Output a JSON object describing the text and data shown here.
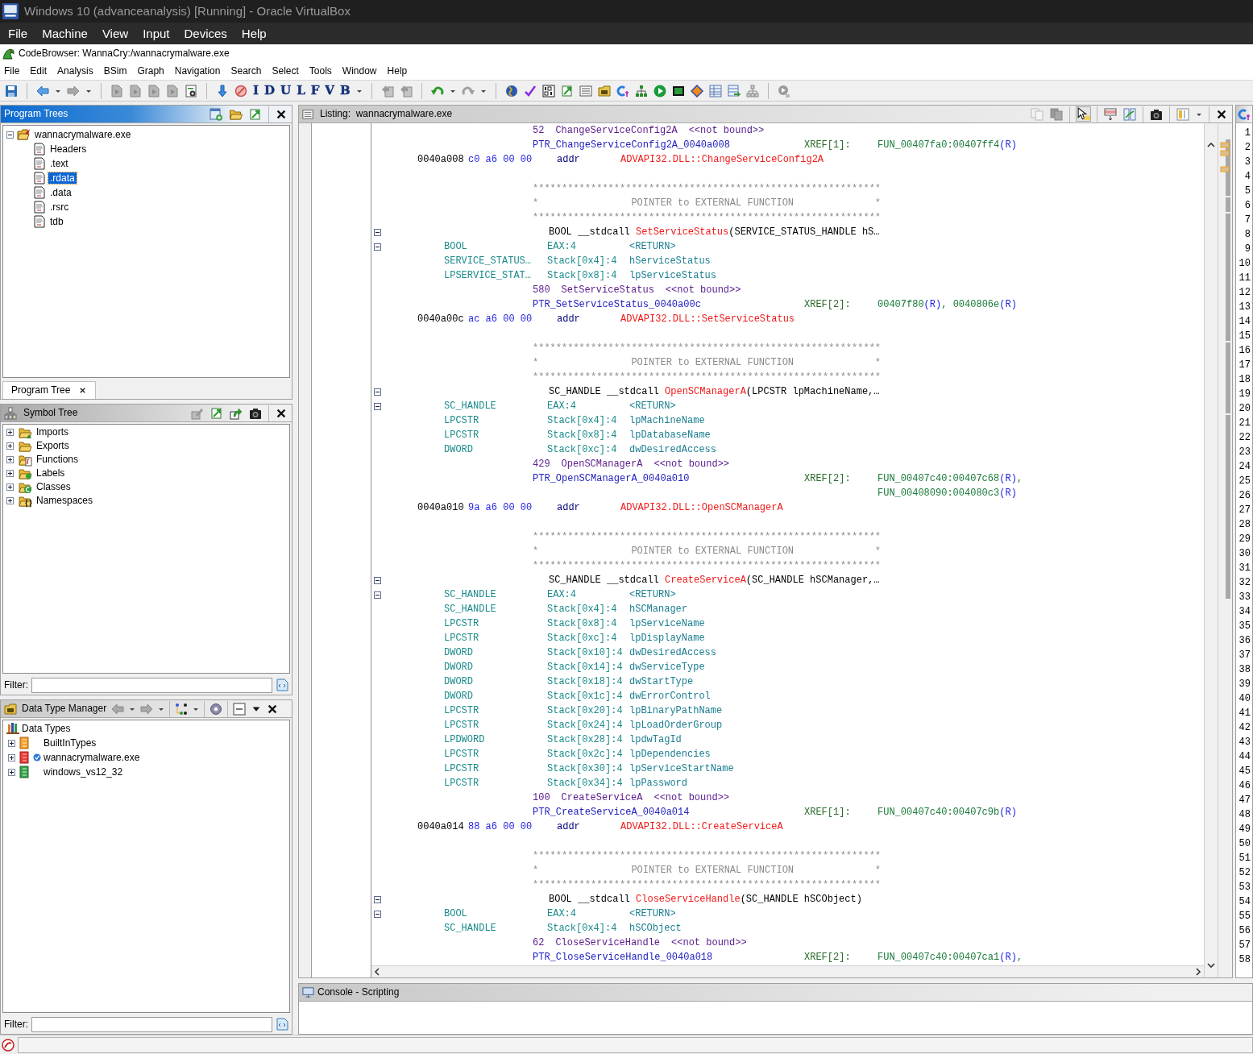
{
  "vm_window": {
    "title": "Windows 10 (advanceanalysis) [Running] - Oracle VirtualBox",
    "menu": [
      "File",
      "Machine",
      "View",
      "Input",
      "Devices",
      "Help"
    ]
  },
  "app": {
    "title": "CodeBrowser: WannaCry:/wannacrymalware.exe",
    "menu": [
      "File",
      "Edit",
      "Analysis",
      "BSim",
      "Graph",
      "Navigation",
      "Search",
      "Select",
      "Tools",
      "Window",
      "Help"
    ],
    "toolbar_letters": [
      "I",
      "D",
      "U",
      "L",
      "F",
      "V",
      "B"
    ]
  },
  "program_trees": {
    "title": "Program Trees",
    "root": {
      "label": "wannacrymalware.exe",
      "expanded": true,
      "children": [
        {
          "label": "Headers",
          "selected": false
        },
        {
          "label": ".text",
          "selected": false
        },
        {
          "label": ".rdata",
          "selected": true
        },
        {
          "label": ".data",
          "selected": false
        },
        {
          "label": ".rsrc",
          "selected": false
        },
        {
          "label": "tdb",
          "selected": false
        }
      ]
    },
    "tabs": [
      {
        "label": "Program Tree",
        "selected": true
      }
    ]
  },
  "symbol_tree": {
    "title": "Symbol Tree",
    "items": [
      {
        "label": "Imports",
        "kind": "imports",
        "expanded": false
      },
      {
        "label": "Exports",
        "kind": "exports",
        "expanded": false
      },
      {
        "label": "Functions",
        "kind": "functions",
        "expanded": false
      },
      {
        "label": "Labels",
        "kind": "labels",
        "expanded": false
      },
      {
        "label": "Classes",
        "kind": "classes",
        "expanded": false
      },
      {
        "label": "Namespaces",
        "kind": "namespaces",
        "expanded": false
      }
    ],
    "filter": {
      "label": "Filter:"
    }
  },
  "data_type_manager": {
    "title": "Data Type Manager",
    "root": {
      "label": "Data Types",
      "children": [
        {
          "label": "BuiltInTypes",
          "kind": "builtin",
          "expanded": false
        },
        {
          "label": "wannacrymalware.exe",
          "kind": "program",
          "expanded": false
        },
        {
          "label": "windows_vs12_32",
          "kind": "archive",
          "expanded": false
        }
      ]
    },
    "filter": {
      "label": "Filter:"
    }
  },
  "listing": {
    "title": "Listing:  wannacrymalware.exe",
    "lines": [
      {
        "kind": "ordinal",
        "number": "52",
        "name": "ChangeServiceConfig2A",
        "note": "<<not bound>>"
      },
      {
        "kind": "label",
        "label": "PTR_ChangeServiceConfig2A_0040a008",
        "xref": "XREF[1]:",
        "refs": [
          {
            "target": "FUN_00407fa0:00407ff4",
            "access": "(R)"
          }
        ]
      },
      {
        "kind": "data",
        "address": "0040a008",
        "bytes": "c0 a6 00 00",
        "mnemonic": "addr",
        "operand": "ADVAPI32.DLL::ChangeServiceConfig2A"
      },
      {
        "kind": "blank"
      },
      {
        "kind": "stars",
        "text": "************************************************************"
      },
      {
        "kind": "banner",
        "text": "*                POINTER to EXTERNAL FUNCTION              *"
      },
      {
        "kind": "stars",
        "text": "************************************************************"
      },
      {
        "kind": "signature",
        "fold": true,
        "ret": "BOOL",
        "conv": "__stdcall",
        "name": "SetServiceStatus",
        "params": "(SERVICE_STATUS_HANDLE hS…"
      },
      {
        "kind": "param",
        "fold": true,
        "type": "BOOL",
        "storage": "EAX:4",
        "name": "<RETURN>"
      },
      {
        "kind": "param",
        "type": "SERVICE_STATUS…",
        "storage": "Stack[0x4]:4",
        "name": "hServiceStatus"
      },
      {
        "kind": "param",
        "type": "LPSERVICE_STAT…",
        "storage": "Stack[0x8]:4",
        "name": "lpServiceStatus"
      },
      {
        "kind": "ordinal",
        "number": "580",
        "name": "SetServiceStatus",
        "note": "<<not bound>>"
      },
      {
        "kind": "label",
        "label": "PTR_SetServiceStatus_0040a00c",
        "xref": "XREF[2]:",
        "refs": [
          {
            "target": "00407f80",
            "access": "(R)",
            "sep": ", "
          },
          {
            "target": "0040806e",
            "access": "(R)"
          }
        ]
      },
      {
        "kind": "data",
        "address": "0040a00c",
        "bytes": "ac a6 00 00",
        "mnemonic": "addr",
        "operand": "ADVAPI32.DLL::SetServiceStatus"
      },
      {
        "kind": "blank"
      },
      {
        "kind": "stars",
        "text": "************************************************************"
      },
      {
        "kind": "banner",
        "text": "*                POINTER to EXTERNAL FUNCTION              *"
      },
      {
        "kind": "stars",
        "text": "************************************************************"
      },
      {
        "kind": "signature",
        "fold": true,
        "ret": "SC_HANDLE",
        "conv": "__stdcall",
        "name": "OpenSCManagerA",
        "params": "(LPCSTR lpMachineName,…"
      },
      {
        "kind": "param",
        "fold": true,
        "type": "SC_HANDLE",
        "storage": "EAX:4",
        "name": "<RETURN>"
      },
      {
        "kind": "param",
        "type": "LPCSTR",
        "storage": "Stack[0x4]:4",
        "name": "lpMachineName"
      },
      {
        "kind": "param",
        "type": "LPCSTR",
        "storage": "Stack[0x8]:4",
        "name": "lpDatabaseName"
      },
      {
        "kind": "param",
        "type": "DWORD",
        "storage": "Stack[0xc]:4",
        "name": "dwDesiredAccess"
      },
      {
        "kind": "ordinal",
        "number": "429",
        "name": "OpenSCManagerA",
        "note": "<<not bound>>"
      },
      {
        "kind": "label",
        "label": "PTR_OpenSCManagerA_0040a010",
        "xref": "XREF[2]:",
        "refs": [
          {
            "target": "FUN_00407c40:00407c68",
            "access": "(R)",
            "sep": ","
          }
        ]
      },
      {
        "kind": "xref",
        "refs": [
          {
            "target": "FUN_00408090:004080c3",
            "access": "(R)"
          }
        ]
      },
      {
        "kind": "data",
        "address": "0040a010",
        "bytes": "9a a6 00 00",
        "mnemonic": "addr",
        "operand": "ADVAPI32.DLL::OpenSCManagerA"
      },
      {
        "kind": "blank"
      },
      {
        "kind": "stars",
        "text": "************************************************************"
      },
      {
        "kind": "banner",
        "text": "*                POINTER to EXTERNAL FUNCTION              *"
      },
      {
        "kind": "stars",
        "text": "************************************************************"
      },
      {
        "kind": "signature",
        "fold": true,
        "ret": "SC_HANDLE",
        "conv": "__stdcall",
        "name": "CreateServiceA",
        "params": "(SC_HANDLE hSCManager,…"
      },
      {
        "kind": "param",
        "fold": true,
        "type": "SC_HANDLE",
        "storage": "EAX:4",
        "name": "<RETURN>"
      },
      {
        "kind": "param",
        "type": "SC_HANDLE",
        "storage": "Stack[0x4]:4",
        "name": "hSCManager"
      },
      {
        "kind": "param",
        "type": "LPCSTR",
        "storage": "Stack[0x8]:4",
        "name": "lpServiceName"
      },
      {
        "kind": "param",
        "type": "LPCSTR",
        "storage": "Stack[0xc]:4",
        "name": "lpDisplayName"
      },
      {
        "kind": "param",
        "type": "DWORD",
        "storage": "Stack[0x10]:4",
        "name": "dwDesiredAccess"
      },
      {
        "kind": "param",
        "type": "DWORD",
        "storage": "Stack[0x14]:4",
        "name": "dwServiceType"
      },
      {
        "kind": "param",
        "type": "DWORD",
        "storage": "Stack[0x18]:4",
        "name": "dwStartType"
      },
      {
        "kind": "param",
        "type": "DWORD",
        "storage": "Stack[0x1c]:4",
        "name": "dwErrorControl"
      },
      {
        "kind": "param",
        "type": "LPCSTR",
        "storage": "Stack[0x20]:4",
        "name": "lpBinaryPathName"
      },
      {
        "kind": "param",
        "type": "LPCSTR",
        "storage": "Stack[0x24]:4",
        "name": "lpLoadOrderGroup"
      },
      {
        "kind": "param",
        "type": "LPDWORD",
        "storage": "Stack[0x28]:4",
        "name": "lpdwTagId"
      },
      {
        "kind": "param",
        "type": "LPCSTR",
        "storage": "Stack[0x2c]:4",
        "name": "lpDependencies"
      },
      {
        "kind": "param",
        "type": "LPCSTR",
        "storage": "Stack[0x30]:4",
        "name": "lpServiceStartName"
      },
      {
        "kind": "param",
        "type": "LPCSTR",
        "storage": "Stack[0x34]:4",
        "name": "lpPassword"
      },
      {
        "kind": "ordinal",
        "number": "100",
        "name": "CreateServiceA",
        "note": "<<not bound>>"
      },
      {
        "kind": "label",
        "label": "PTR_CreateServiceA_0040a014",
        "xref": "XREF[1]:",
        "refs": [
          {
            "target": "FUN_00407c40:00407c9b",
            "access": "(R)"
          }
        ]
      },
      {
        "kind": "data",
        "address": "0040a014",
        "bytes": "88 a6 00 00",
        "mnemonic": "addr",
        "operand": "ADVAPI32.DLL::CreateServiceA"
      },
      {
        "kind": "blank"
      },
      {
        "kind": "stars",
        "text": "************************************************************"
      },
      {
        "kind": "banner",
        "text": "*                POINTER to EXTERNAL FUNCTION              *"
      },
      {
        "kind": "stars",
        "text": "************************************************************"
      },
      {
        "kind": "signature",
        "fold": true,
        "ret": "BOOL",
        "conv": "__stdcall",
        "name": "CloseServiceHandle",
        "params": "(SC_HANDLE hSCObject)"
      },
      {
        "kind": "param",
        "fold": true,
        "type": "BOOL",
        "storage": "EAX:4",
        "name": "<RETURN>"
      },
      {
        "kind": "param",
        "type": "SC_HANDLE",
        "storage": "Stack[0x4]:4",
        "name": "hSCObject"
      },
      {
        "kind": "ordinal",
        "number": "62",
        "name": "CloseServiceHandle",
        "note": "<<not bound>>"
      },
      {
        "kind": "label",
        "label": "PTR_CloseServiceHandle_0040a018",
        "xref": "XREF[2]:",
        "refs": [
          {
            "target": "FUN_00407c40:00407ca1",
            "access": "(R)",
            "sep": ","
          }
        ]
      }
    ]
  },
  "line_numbers": [
    "1",
    "2",
    "3",
    "4",
    "5",
    "6",
    "7",
    "8",
    "9",
    "10",
    "11",
    "12",
    "13",
    "14",
    "15",
    "16",
    "17",
    "18",
    "19",
    "20",
    "21",
    "22",
    "23",
    "24",
    "25",
    "26",
    "27",
    "28",
    "29",
    "30",
    "31",
    "32",
    "33",
    "34",
    "35",
    "36",
    "37",
    "38",
    "39",
    "40",
    "41",
    "42",
    "43",
    "44",
    "45",
    "46",
    "47",
    "48",
    "49",
    "50",
    "51",
    "52",
    "53",
    "54",
    "55",
    "56",
    "57",
    "58"
  ],
  "console": {
    "title": "Console - Scripting"
  }
}
